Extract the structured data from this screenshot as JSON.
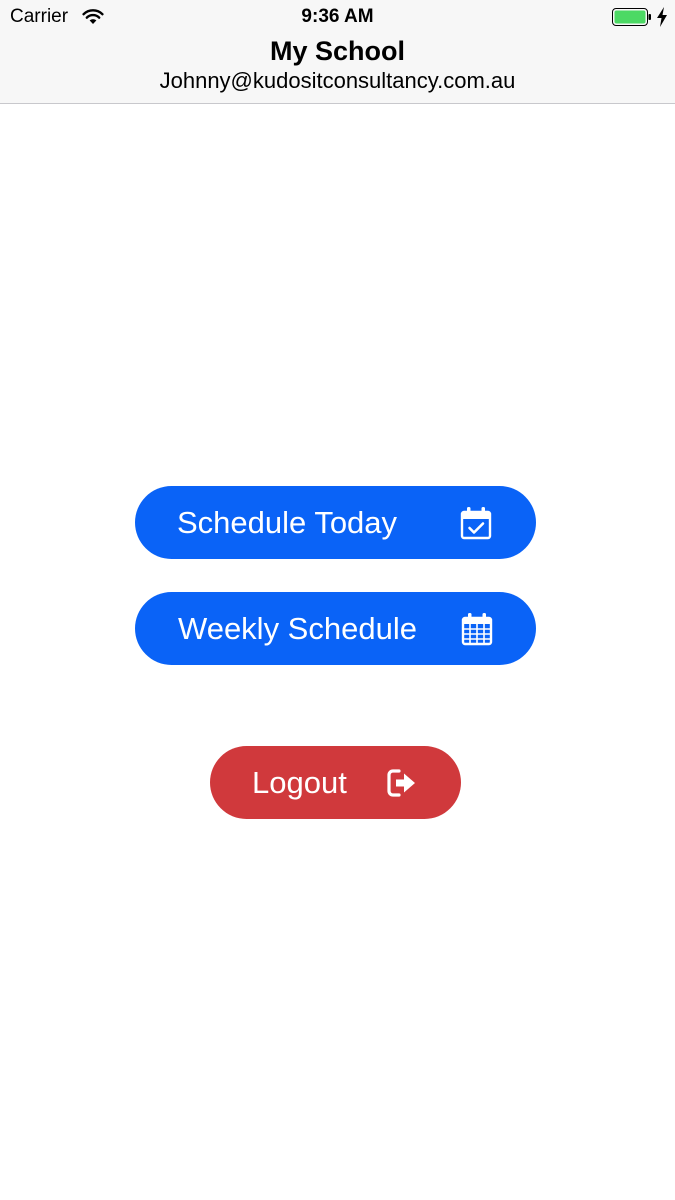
{
  "status_bar": {
    "carrier": "Carrier",
    "time": "9:36 AM",
    "battery_level": 1.0,
    "charging": true
  },
  "header": {
    "title": "My School",
    "subtitle": "Johnny@kudositconsultancy.com.au"
  },
  "buttons": {
    "schedule_today": {
      "label": "Schedule Today",
      "icon": "calendar-check-icon"
    },
    "weekly_schedule": {
      "label": "Weekly Schedule",
      "icon": "calendar-grid-icon"
    },
    "logout": {
      "label": "Logout",
      "icon": "sign-out-icon"
    }
  },
  "colors": {
    "primary": "#0a63f7",
    "danger": "#d0393c",
    "battery": "#4cd964"
  }
}
